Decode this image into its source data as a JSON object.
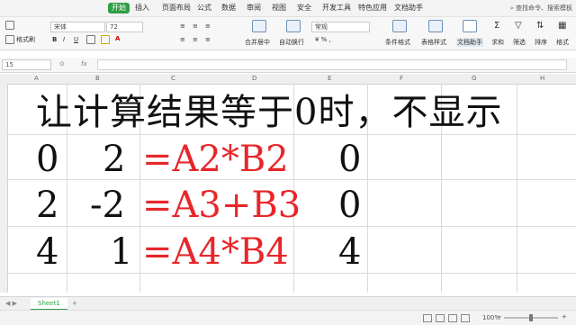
{
  "menubar": {
    "tabs": [
      "开始",
      "插入",
      "页面布局",
      "公式",
      "数据",
      "审阅",
      "视图",
      "安全",
      "开发工具",
      "特色应用",
      "文档助手"
    ],
    "active_tab": "开始",
    "search_text": "查找命令、搜索模板"
  },
  "ribbon": {
    "format_painter_label": "格式刷",
    "font_name": "宋体",
    "font_size": "72",
    "merge_center_label": "合并居中",
    "auto_wrap_label": "自动换行",
    "number_format": "常规",
    "conditional_format_label": "条件格式",
    "table_style_label": "表格样式",
    "doc_assistant_label": "文档助手",
    "sum_label": "求和",
    "filter_label": "筛选",
    "sort_label": "排序",
    "format_label": "格式"
  },
  "formula_bar": {
    "name_box": "15",
    "formula": ""
  },
  "column_headers": [
    "A",
    "B",
    "C",
    "D",
    "E",
    "F",
    "G",
    "H"
  ],
  "title_text": "让计算结果等于0时，不显示",
  "rows": [
    {
      "a": "0",
      "b": "2",
      "formula": "=A2*B2",
      "result": "0"
    },
    {
      "a": "2",
      "b": "-2",
      "formula": "=A3+B3",
      "result": "0"
    },
    {
      "a": "4",
      "b": "1",
      "formula": "=A4*B4",
      "result": "4"
    }
  ],
  "sheet_tabs": [
    "Sheet1"
  ],
  "status": {
    "zoom": "100%"
  },
  "colors": {
    "formula_text": "#e8262a",
    "accent": "#2f9e44"
  }
}
